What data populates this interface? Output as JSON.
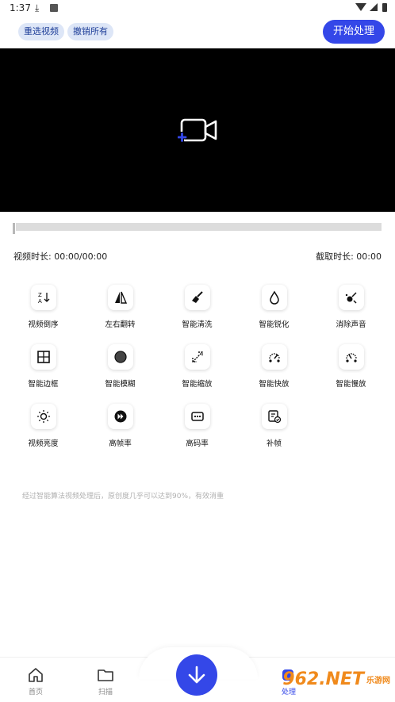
{
  "status_bar": {
    "time": "1:37"
  },
  "top_actions": {
    "reselect_label": "重选视频",
    "undo_all_label": "撤销所有",
    "start_label": "开始处理"
  },
  "video": {
    "duration_label": "视频时长: 00:00/00:00",
    "clip_label": "截取时长: 00:00"
  },
  "tools": [
    {
      "label": "视频倒序",
      "icon": "reverse-sort-icon"
    },
    {
      "label": "左右翻转",
      "icon": "flip-horizontal-icon"
    },
    {
      "label": "智能清洗",
      "icon": "broom-icon"
    },
    {
      "label": "智能锐化",
      "icon": "drop-icon"
    },
    {
      "label": "消除声音",
      "icon": "mute-icon"
    },
    {
      "label": "智能边框",
      "icon": "border-icon"
    },
    {
      "label": "智能模糊",
      "icon": "blur-icon"
    },
    {
      "label": "智能缩放",
      "icon": "zoom-icon"
    },
    {
      "label": "智能快放",
      "icon": "fast-speed-icon"
    },
    {
      "label": "智能慢放",
      "icon": "slow-speed-icon"
    },
    {
      "label": "视频亮度",
      "icon": "brightness-icon"
    },
    {
      "label": "高帧率",
      "icon": "high-fps-icon"
    },
    {
      "label": "高码率",
      "icon": "bitrate-icon"
    },
    {
      "label": "补帧",
      "icon": "frame-fill-icon"
    }
  ],
  "hint": "经过智能算法视频处理后，原创度几乎可以达到90%，有效消重",
  "bottom_nav": {
    "home": "首页",
    "scan": "扫描",
    "process": "处理"
  },
  "watermark": {
    "main": "962.NET",
    "sub": "乐游网"
  },
  "colors": {
    "accent": "#3447e8",
    "chip_bg": "#dde6f7"
  }
}
